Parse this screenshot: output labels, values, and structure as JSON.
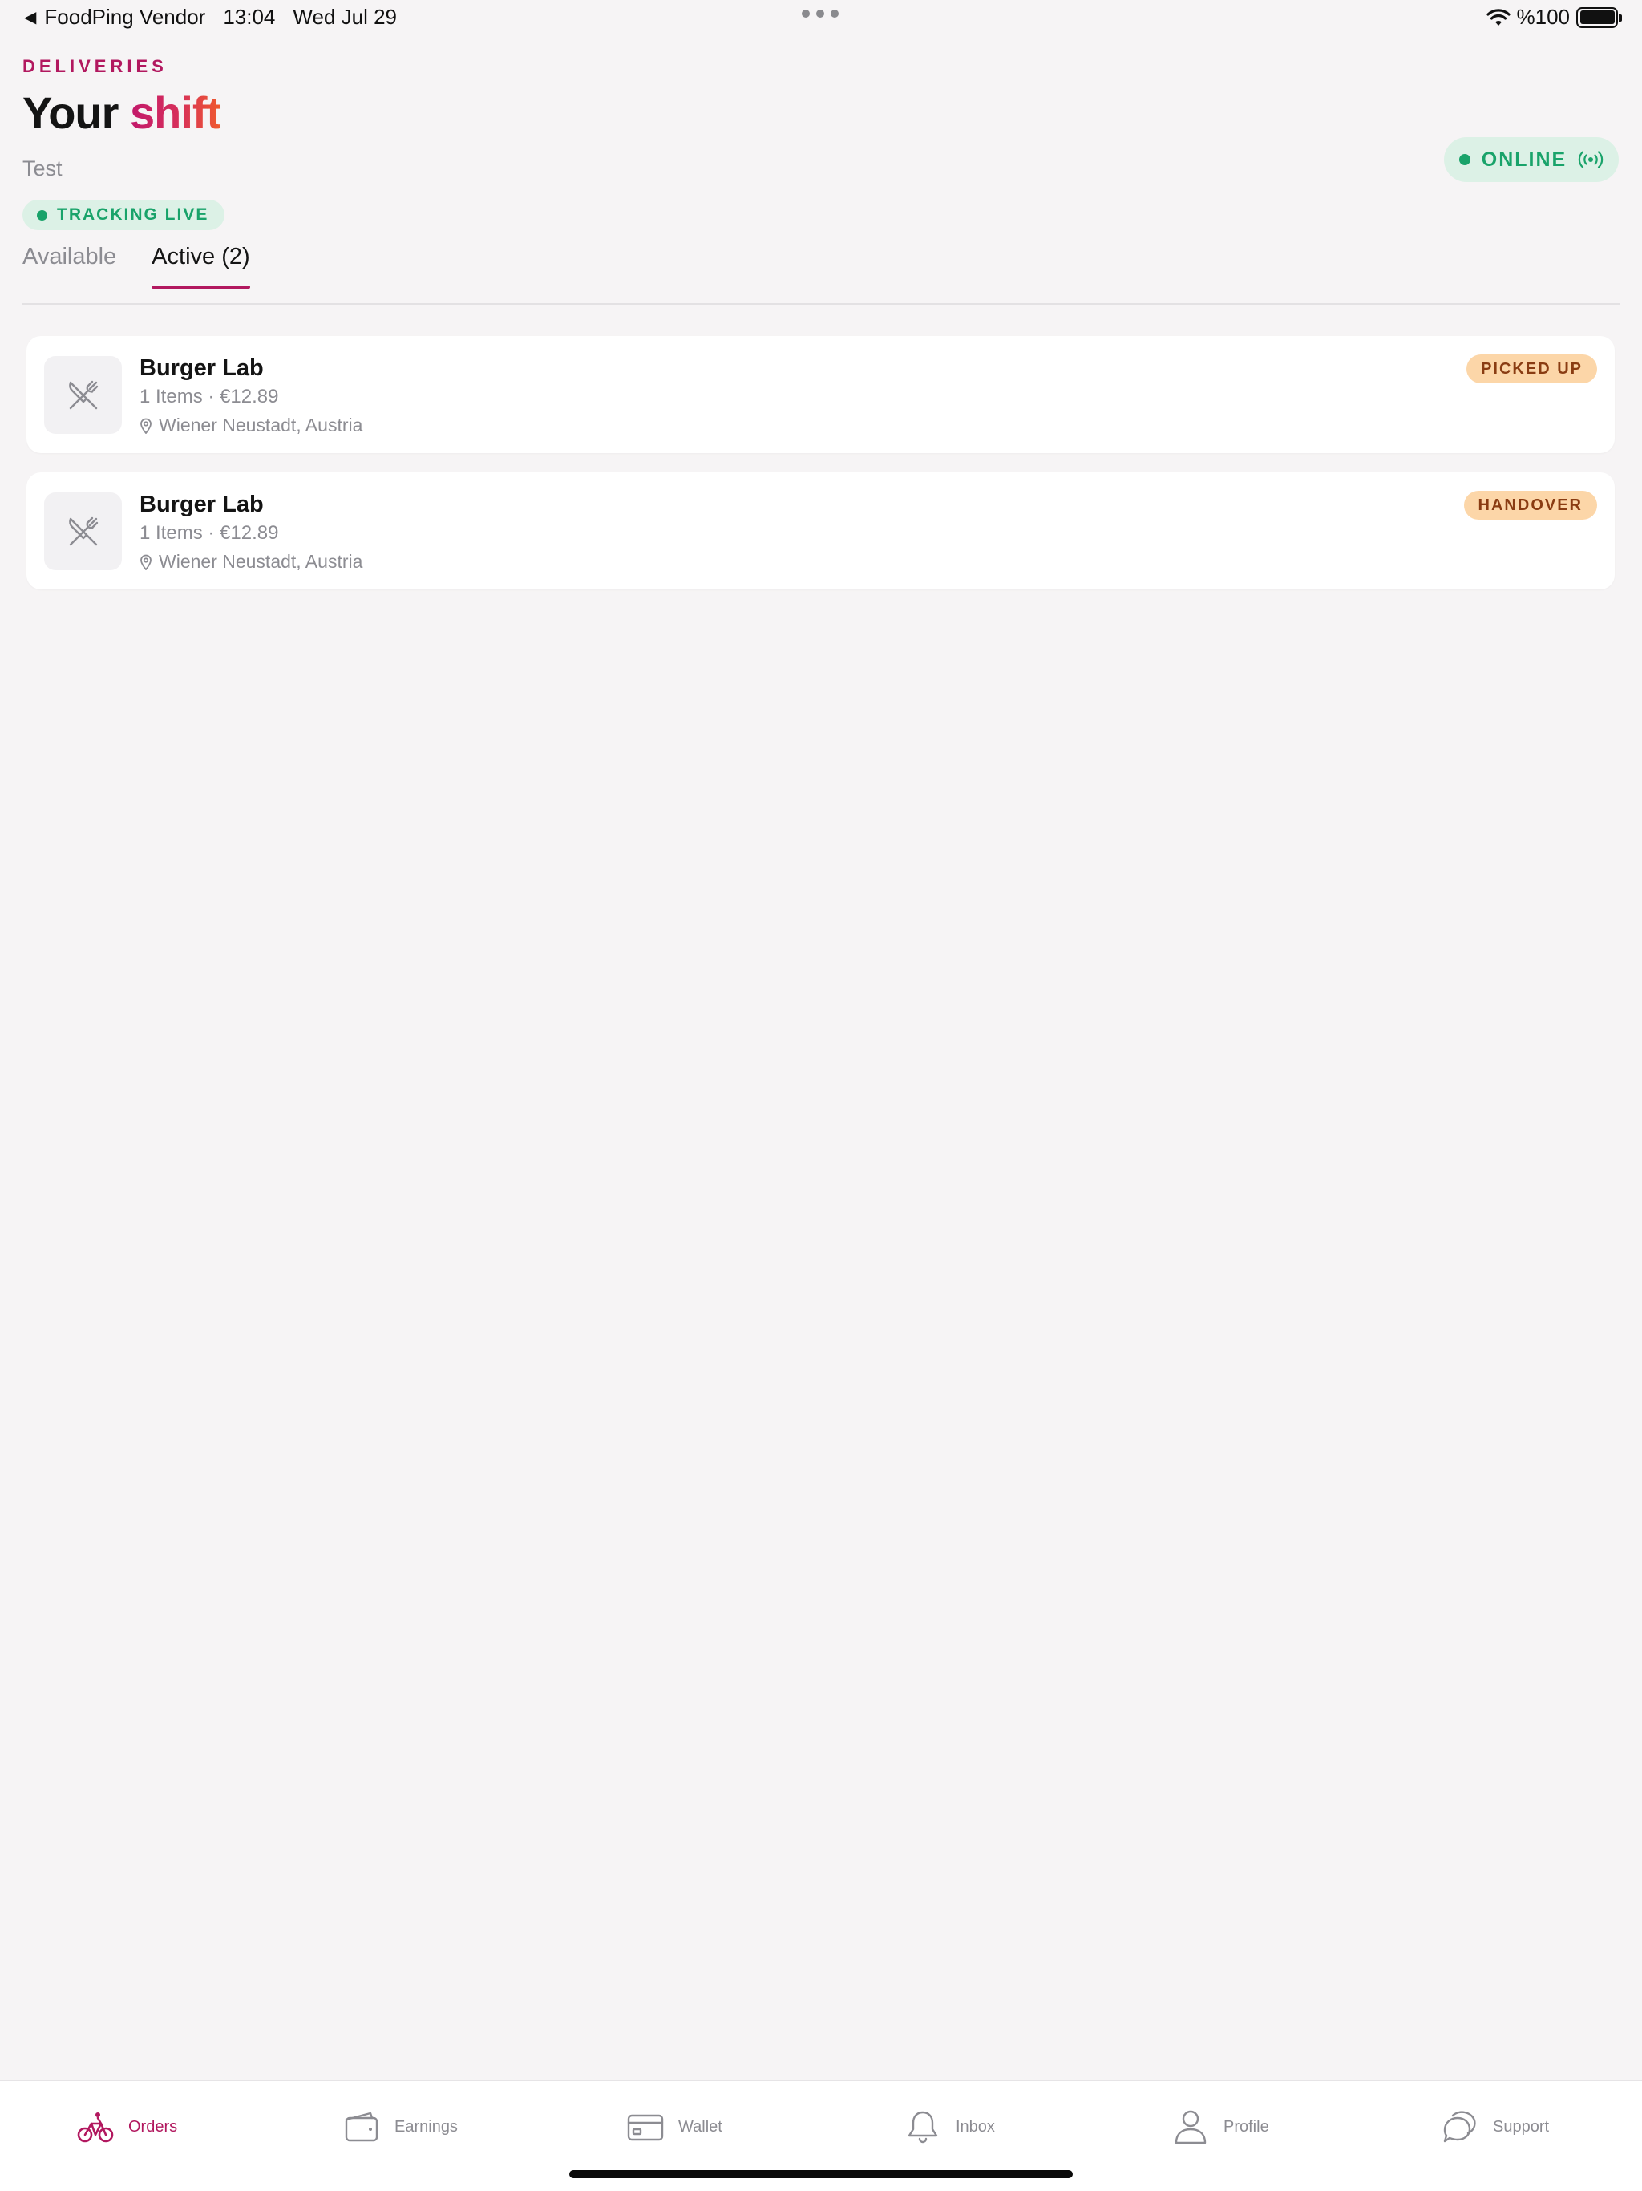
{
  "status_bar": {
    "back_app": "FoodPing Vendor",
    "time": "13:04",
    "date": "Wed Jul 29",
    "battery": "%100"
  },
  "header": {
    "eyebrow": "DELIVERIES",
    "title_plain": "Your",
    "title_accent": "shift",
    "subtitle": "Test",
    "tracking_label": "TRACKING LIVE",
    "online_label": "ONLINE"
  },
  "tabs": [
    {
      "label": "Available",
      "active": false
    },
    {
      "label": "Active (2)",
      "active": true
    }
  ],
  "orders": [
    {
      "restaurant": "Burger Lab",
      "items": "1 Items · €12.89",
      "location": "Wiener Neustadt, Austria",
      "status": "PICKED UP"
    },
    {
      "restaurant": "Burger Lab",
      "items": "1 Items · €12.89",
      "location": "Wiener Neustadt, Austria",
      "status": "HANDOVER"
    }
  ],
  "bottom_nav": [
    {
      "label": "Orders",
      "icon": "bicycle-icon",
      "active": true
    },
    {
      "label": "Earnings",
      "icon": "wallet-icon",
      "active": false
    },
    {
      "label": "Wallet",
      "icon": "credit-card-icon",
      "active": false
    },
    {
      "label": "Inbox",
      "icon": "bell-icon",
      "active": false
    },
    {
      "label": "Profile",
      "icon": "person-icon",
      "active": false
    },
    {
      "label": "Support",
      "icon": "chat-bubbles-icon",
      "active": false
    }
  ],
  "colors": {
    "brand": "#b2185f",
    "online_green": "#19a36a",
    "badge_bg": "#fcd6a8",
    "background": "#f6f4f5"
  }
}
